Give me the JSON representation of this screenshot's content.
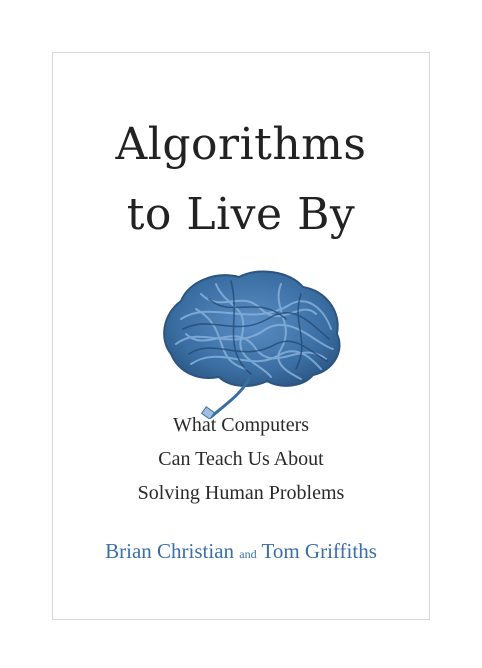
{
  "cover": {
    "title_line1": "Algorithms",
    "title_line2": "to Live By",
    "subtitle_line1": "What Computers",
    "subtitle_line2": "Can Teach Us About",
    "subtitle_line3": "Solving Human Problems",
    "author1": "Brian Christian",
    "conjunction": "and",
    "author2": "Tom Griffiths"
  },
  "colors": {
    "author_text": "#3a6fa8",
    "brain_cable": "#3b6fa3",
    "title_text": "#222222"
  },
  "icons": {
    "illustration": "cable-brain-icon"
  }
}
